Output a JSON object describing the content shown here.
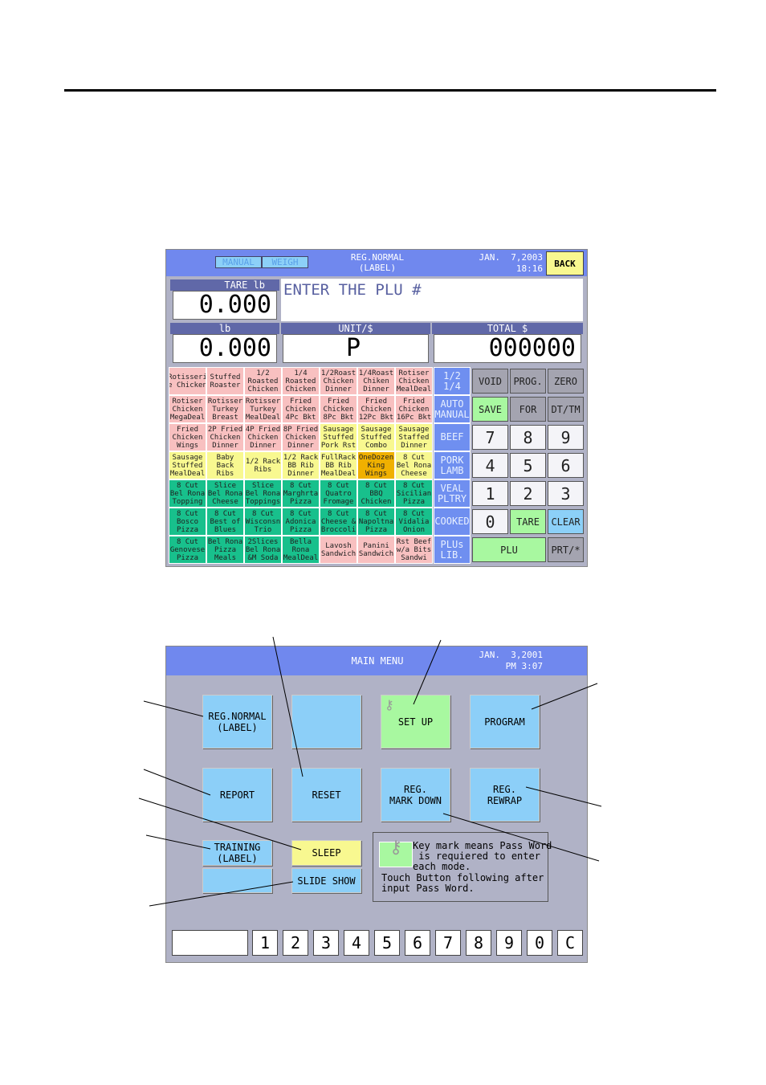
{
  "screen1": {
    "mode_tabs": [
      "MANUAL",
      "WEIGH"
    ],
    "title": "REG.NORMAL\n(LABEL)",
    "date": "JAN.  7,2003",
    "time": "18:16",
    "back": "BACK",
    "tare_label": "TARE lb",
    "tare_value": "0.000",
    "message": "ENTER THE PLU #",
    "lb_label": "lb",
    "lb_value": "0.000",
    "unit_label": "UNIT/$",
    "unit_value": "P",
    "total_label": "TOTAL $",
    "total_value": "000000",
    "colors": {
      "pink": "#f8c0c0",
      "yellow": "#f8f890",
      "orange": "#f0b000",
      "green": "#18c08c",
      "category": "#6f8ff0"
    },
    "plu_rows": [
      [
        [
          "Rotisseri\ne Chicken",
          "pink"
        ],
        [
          "Stuffed\nRoaster",
          "pink"
        ],
        [
          "1/2\nRoasted\nChicken",
          "pink"
        ],
        [
          "1/4\nRoasted\nChicken",
          "pink"
        ],
        [
          "1/2Roast\nChicken\nDinner",
          "pink"
        ],
        [
          "1/4Roast\nChiken\nDinner",
          "pink"
        ],
        [
          "Rotiser\nChicken\nMealDeal",
          "pink"
        ]
      ],
      [
        [
          "Rotiser\nChicken\nMegaDeal",
          "pink"
        ],
        [
          "Rotisser\nTurkey\nBreast",
          "pink"
        ],
        [
          "Rotisser\nTurkey\nMealDeal",
          "pink"
        ],
        [
          "Fried\nChicken\n4Pc Bkt",
          "pink"
        ],
        [
          "Fried\nChicken\n8Pc Bkt",
          "pink"
        ],
        [
          "Fried\nChicken\n12Pc Bkt",
          "pink"
        ],
        [
          "Fried\nChicken\n16Pc Bkt",
          "pink"
        ]
      ],
      [
        [
          "Fried\nChicken\nWings",
          "pink"
        ],
        [
          "2P Fried\nChicken\nDinner",
          "pink"
        ],
        [
          "4P Fried\nChicken\nDinner",
          "pink"
        ],
        [
          "8P Fried\nChicken\nDinner",
          "pink"
        ],
        [
          "Sausage\nStuffed\nPork Rst",
          "yellow"
        ],
        [
          "Sausage\nStuffed\nCombo",
          "yellow"
        ],
        [
          "Sausage\nStaffed\nDinner",
          "yellow"
        ]
      ],
      [
        [
          "Sausage\nStuffed\nMealDeal",
          "yellow"
        ],
        [
          "Baby\nBack\nRibs",
          "yellow"
        ],
        [
          "1/2 Rack\nRibs",
          "yellow"
        ],
        [
          "1/2 Rack\nBB Rib\nDinner",
          "yellow"
        ],
        [
          "FullRack\nBB Rib\nMealDeal",
          "yellow"
        ],
        [
          "OneDozen\nKing\nWings",
          "orange"
        ],
        [
          "8 Cut\nBel Rona\nCheese",
          "yellow"
        ]
      ],
      [
        [
          "8 Cut\nBel Rona\nTopping",
          "green"
        ],
        [
          "Slice\nBel Rona\nCheese",
          "green"
        ],
        [
          "Slice\nBel Rona\nToppings",
          "green"
        ],
        [
          "8 Cut\nMarghrta\nPizza",
          "green"
        ],
        [
          "8 Cut\nQuatro\nFromage",
          "green"
        ],
        [
          "8 Cut\nBBQ\nChicken",
          "green"
        ],
        [
          "8 Cut\nSicilian\nPizza",
          "green"
        ]
      ],
      [
        [
          "8 Cut\nBosco\nPizza",
          "green"
        ],
        [
          "8 Cut\nBest of\nBlues",
          "green"
        ],
        [
          "8 Cut\nWisconsn\nTrio",
          "green"
        ],
        [
          "8 Cut\nAdonica\nPizza",
          "green"
        ],
        [
          "8 Cut\nCheese &\nBroccoli",
          "green"
        ],
        [
          "8 Cut\nNapoltna\nPizza",
          "green"
        ],
        [
          "8 Cut\nVidalia\nOnion",
          "green"
        ]
      ],
      [
        [
          "8 Cut\nGenovese\nPizza",
          "green"
        ],
        [
          "Bel Rona\nPizza\nMeals",
          "green"
        ],
        [
          "2Slices\nBel Rona\n&M Soda",
          "green"
        ],
        [
          "Bella\nRona\nMealDeal",
          "green"
        ],
        [
          "Lavosh\nSandwich",
          "pink"
        ],
        [
          "Panini\nSandwich",
          "pink"
        ],
        [
          "Rst Beef\nw/a Bits\nSandwi",
          "pink"
        ]
      ]
    ],
    "categories": [
      "1/2\n1/4",
      "AUTO\nMANUAL",
      "BEEF",
      "PORK\nLAMB",
      "VEAL\nPLTRY",
      "COOKED",
      "PLUs\nLIB."
    ],
    "keys": [
      [
        [
          "VOID",
          "gray"
        ],
        [
          "PROG.",
          "gray"
        ],
        [
          "ZERO",
          "gray"
        ]
      ],
      [
        [
          "SAVE",
          "green"
        ],
        [
          "FOR",
          "gray"
        ],
        [
          "DT/TM",
          "gray"
        ]
      ],
      [
        [
          "7",
          "white"
        ],
        [
          "8",
          "white"
        ],
        [
          "9",
          "white"
        ]
      ],
      [
        [
          "4",
          "white"
        ],
        [
          "5",
          "white"
        ],
        [
          "6",
          "white"
        ]
      ],
      [
        [
          "1",
          "white"
        ],
        [
          "2",
          "white"
        ],
        [
          "3",
          "white"
        ]
      ],
      [
        [
          "0",
          "white"
        ],
        [
          "TARE",
          "green"
        ],
        [
          "CLEAR",
          "blue"
        ]
      ],
      [
        [
          "PLU",
          "green"
        ],
        [
          "PRT/*",
          "gray"
        ]
      ]
    ]
  },
  "screen2": {
    "title": "MAIN MENU",
    "date": "JAN.  3,2001",
    "time": "PM 3:07",
    "buttons": {
      "reg_normal": "REG.NORMAL\n(LABEL)",
      "blank": "",
      "setup": "SET UP",
      "program": "PROGRAM",
      "report": "REPORT",
      "reset": "RESET",
      "reg_markdown": "REG.\nMARK DOWN",
      "reg_rewrap": "REG.\nREWRAP",
      "training": "TRAINING\n(LABEL)",
      "sleep": "SLEEP",
      "slide_show": "SLIDE SHOW"
    },
    "note_line1": "Key mark means Pass Word\n is requiered to enter\neach mode.",
    "note_line2": "Touch Button following after\ninput Pass Word.",
    "keypad": [
      "1",
      "2",
      "3",
      "4",
      "5",
      "6",
      "7",
      "8",
      "9",
      "0",
      "C"
    ]
  }
}
